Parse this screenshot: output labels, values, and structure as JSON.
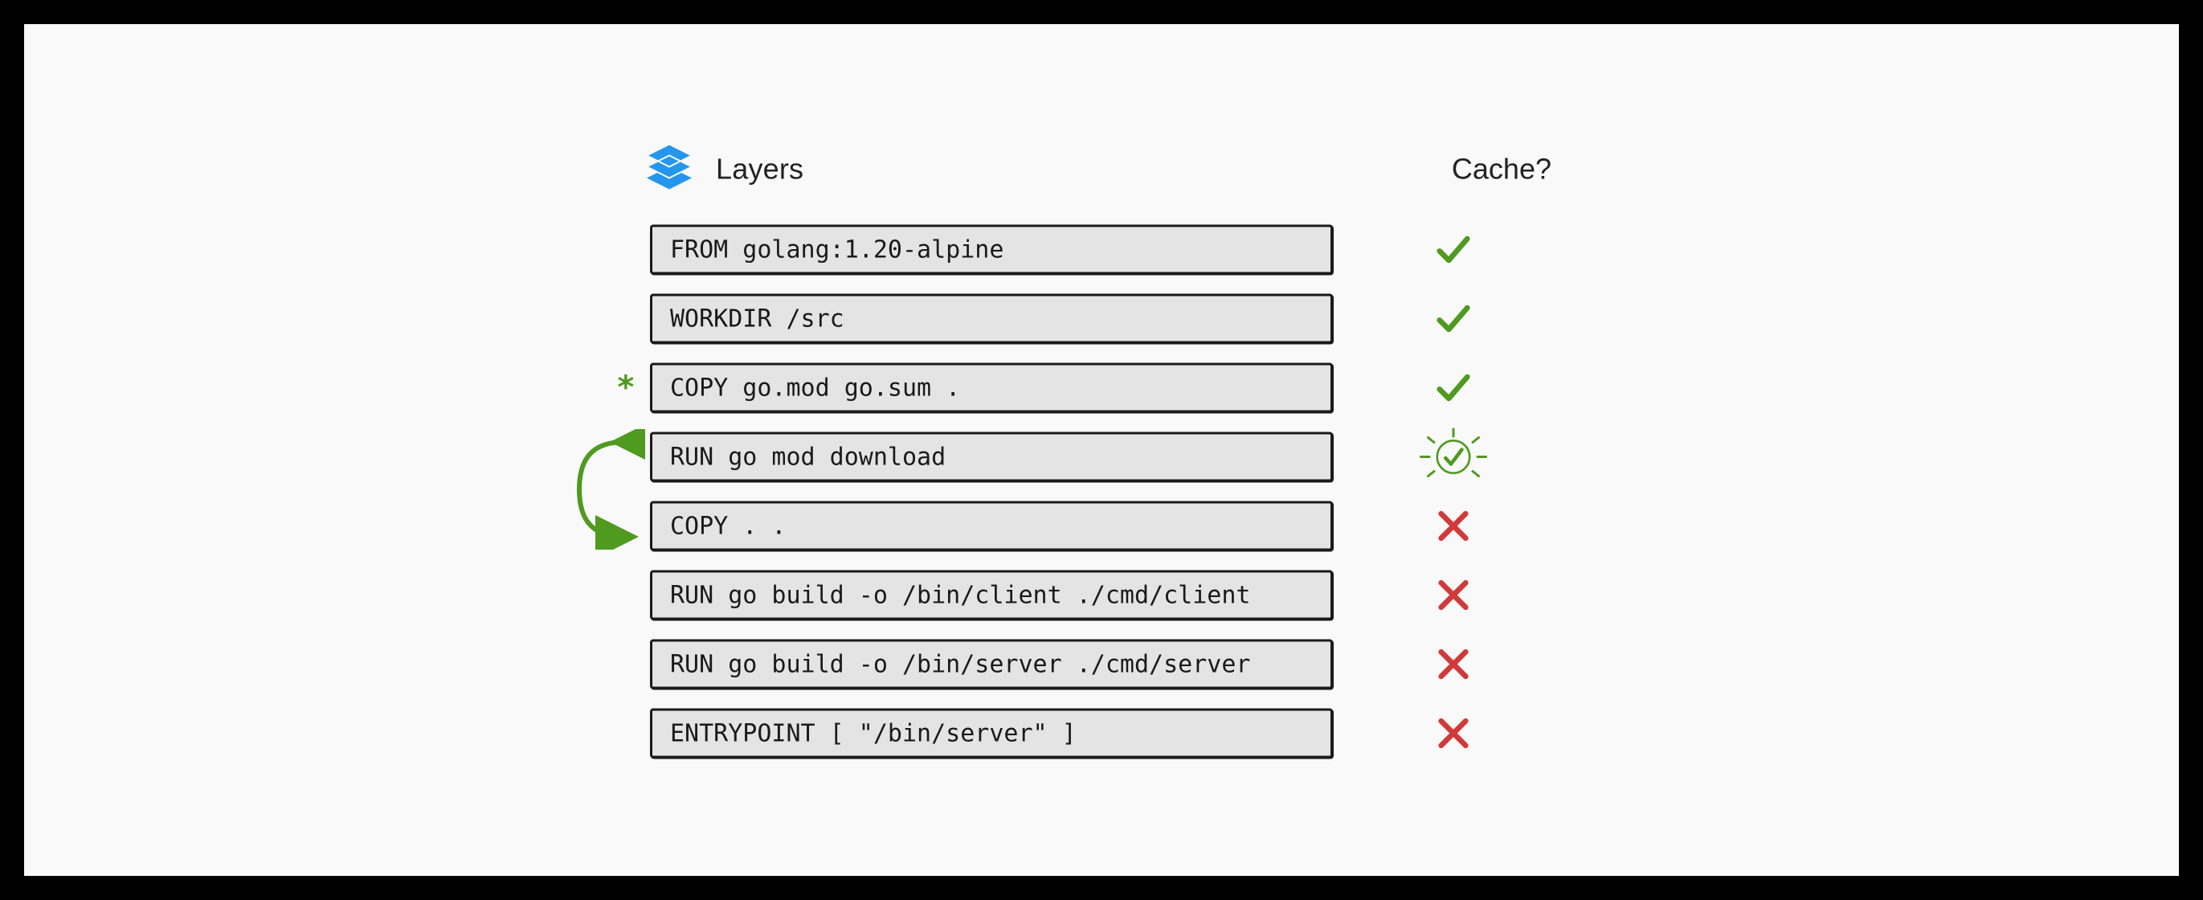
{
  "header": {
    "layers_label": "Layers",
    "cache_label": "Cache?"
  },
  "colors": {
    "green": "#4f9a1f",
    "red": "#d13a3a",
    "blue": "#2496ed",
    "box_bg": "#e4e4e4",
    "box_border": "#1a1a1a"
  },
  "swap_between_rows": [
    3,
    4
  ],
  "rows": [
    {
      "text": "FROM golang:1.20-alpine",
      "cache": "hit",
      "marker": null
    },
    {
      "text": "WORKDIR /src",
      "cache": "hit",
      "marker": null
    },
    {
      "text": "COPY go.mod go.sum .",
      "cache": "hit",
      "marker": "asterisk"
    },
    {
      "text": "RUN go mod download",
      "cache": "hit-highlight",
      "marker": null
    },
    {
      "text": "COPY . .",
      "cache": "miss",
      "marker": null
    },
    {
      "text": "RUN go build -o /bin/client ./cmd/client",
      "cache": "miss",
      "marker": null
    },
    {
      "text": "RUN go build -o /bin/server ./cmd/server",
      "cache": "miss",
      "marker": null
    },
    {
      "text": "ENTRYPOINT [ \"/bin/server\" ]",
      "cache": "miss",
      "marker": null
    }
  ]
}
